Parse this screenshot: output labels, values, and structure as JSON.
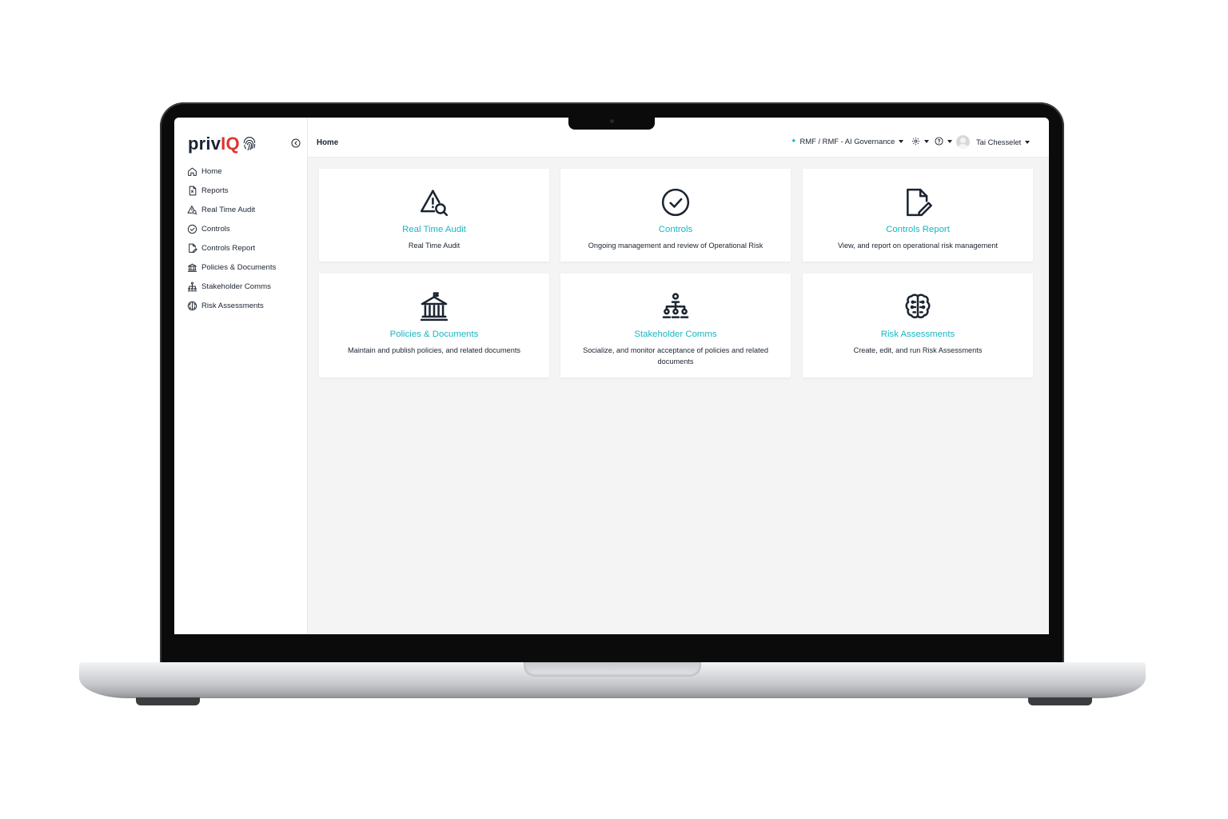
{
  "app": {
    "logo_text": "priv",
    "logo_accent": "IQ",
    "breadcrumb": "Home",
    "environment": "RMF / RMF - AI Governance",
    "user_name": "Tai Chesselet"
  },
  "sidebar": {
    "items": [
      {
        "label": "Home",
        "icon": "home-icon"
      },
      {
        "label": "Reports",
        "icon": "report-file-icon"
      },
      {
        "label": "Real Time Audit",
        "icon": "warning-search-icon"
      },
      {
        "label": "Controls",
        "icon": "check-circle-icon"
      },
      {
        "label": "Controls Report",
        "icon": "file-edit-icon"
      },
      {
        "label": "Policies & Documents",
        "icon": "building-columns-icon"
      },
      {
        "label": "Stakeholder Comms",
        "icon": "hierarchy-icon"
      },
      {
        "label": "Risk Assessments",
        "icon": "brain-icon"
      }
    ]
  },
  "cards": [
    {
      "title": "Real Time Audit",
      "description": "Real Time Audit",
      "icon": "warning-search-icon"
    },
    {
      "title": "Controls",
      "description": "Ongoing management and review of Operational Risk",
      "icon": "check-circle-icon"
    },
    {
      "title": "Controls Report",
      "description": "View, and report on operational risk management",
      "icon": "file-edit-icon"
    },
    {
      "title": "Policies & Documents",
      "description": "Maintain and publish policies, and related documents",
      "icon": "building-columns-icon"
    },
    {
      "title": "Stakeholder Comms",
      "description": "Socialize, and monitor acceptance of policies and related documents",
      "icon": "hierarchy-icon"
    },
    {
      "title": "Risk Assessments",
      "description": "Create, edit, and run Risk Assessments",
      "icon": "brain-icon"
    }
  ],
  "colors": {
    "accent": "#17b6c2",
    "logo_red": "#e0332f",
    "text": "#1b2431",
    "background": "#f4f4f5"
  }
}
